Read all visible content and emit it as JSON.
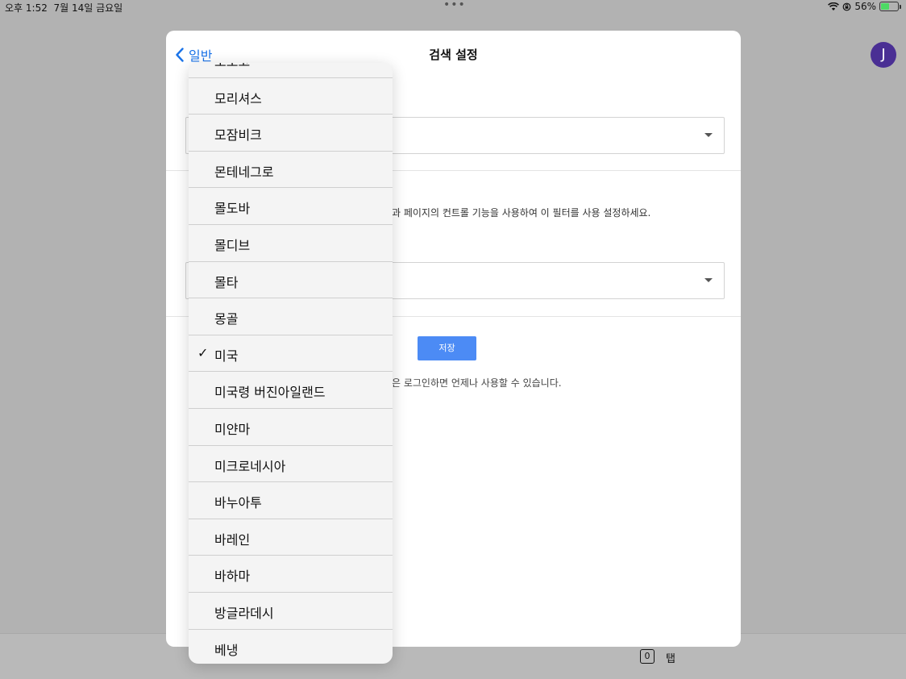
{
  "status_bar": {
    "time": "오후 1:52",
    "date": "7월 14일 금요일",
    "battery_text": "56%",
    "battery_level": 0.56
  },
  "background": {
    "avatar_initial": "J",
    "tabs_count": "0",
    "tabs_label": "탭"
  },
  "modal": {
    "back_label": "일반",
    "title": "검색 설정",
    "description_fragment": "과 페이지의 컨트롤 기능을 사용하여 이 필터를 사용 설정하세요.",
    "save_label": "저장",
    "save_note_fragment": "은 로그인하면 언제나 사용할 수 있습니다."
  },
  "dropdown": {
    "items": [
      {
        "label": "모로코",
        "selected": false
      },
      {
        "label": "모리셔스",
        "selected": false
      },
      {
        "label": "모잠비크",
        "selected": false
      },
      {
        "label": "몬테네그로",
        "selected": false
      },
      {
        "label": "몰도바",
        "selected": false
      },
      {
        "label": "몰디브",
        "selected": false
      },
      {
        "label": "몰타",
        "selected": false
      },
      {
        "label": "몽골",
        "selected": false
      },
      {
        "label": "미국",
        "selected": true
      },
      {
        "label": "미국령 버진아일랜드",
        "selected": false
      },
      {
        "label": "미얀마",
        "selected": false
      },
      {
        "label": "미크로네시아",
        "selected": false
      },
      {
        "label": "바누아투",
        "selected": false
      },
      {
        "label": "바레인",
        "selected": false
      },
      {
        "label": "바하마",
        "selected": false
      },
      {
        "label": "방글라데시",
        "selected": false
      },
      {
        "label": "베냉",
        "selected": false
      }
    ],
    "check_mark": "✓"
  }
}
